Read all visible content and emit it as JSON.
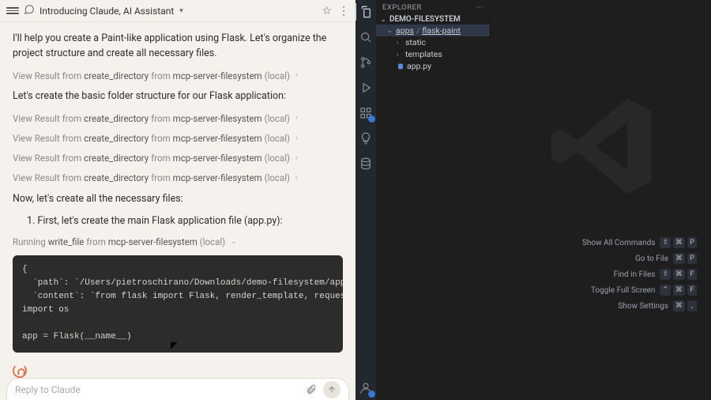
{
  "chat": {
    "title": "Introducing Claude, AI Assistant",
    "intro": "I'll help you create a Paint-like application using Flask. Let's organize the project structure and create all necessary files.",
    "structure_line": "Let's create the basic folder structure for our Flask application:",
    "tool_view": "View Result",
    "tool_from": "from",
    "tool_op_cd": "create_directory",
    "tool_op_wf": "write_file",
    "tool_src": "mcp-server-filesystem",
    "tool_scope": "(local)",
    "running": "Running",
    "now_create": "Now, let's create all the necessary files:",
    "step1": "1. First, let's create the main Flask application file (app.py):",
    "code": "{\n  `path`: `/Users/pietroschirano/Downloads/demo-filesystem/apps/flask-paint/s\n  `content`: `from flask import Flask, render_template, request, jsonify\nimport os\n\napp = Flask(__name__)",
    "reply_placeholder": "Reply to Claude"
  },
  "explorer": {
    "title": "EXPLORER",
    "root": "DEMO-FILESYSTEM",
    "tree": {
      "apps": "apps",
      "flask_paint": "flask-paint",
      "static": "static",
      "templates": "templates",
      "app_py": "app.py"
    }
  },
  "commands": {
    "show_all": "Show All Commands",
    "goto_file": "Go to File",
    "find_in_files": "Find in Files",
    "toggle_full": "Toggle Full Screen",
    "show_settings": "Show Settings",
    "keys": {
      "shift": "⇧",
      "cmd": "⌘",
      "ctrl": "⌃",
      "P": "P",
      "F": "F",
      "comma": ","
    }
  }
}
